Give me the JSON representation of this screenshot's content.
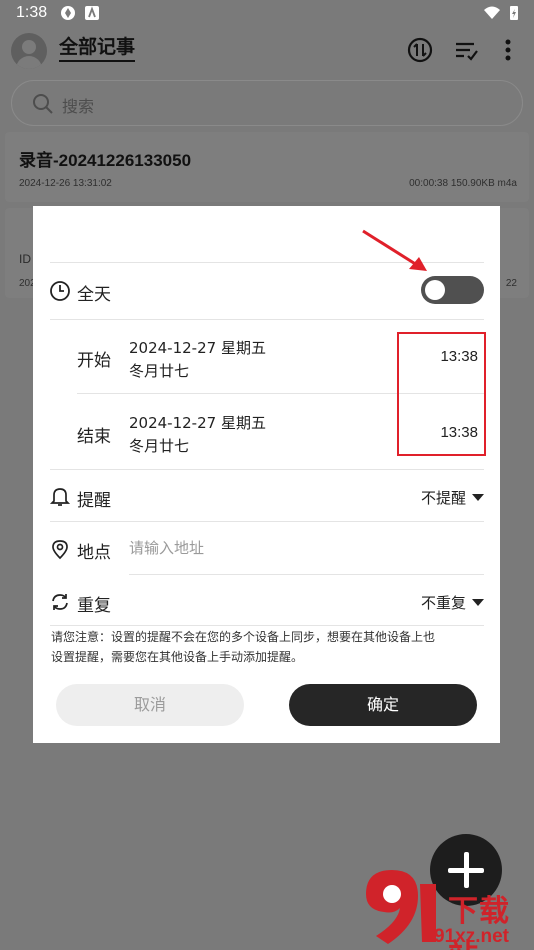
{
  "status_bar": {
    "time": "1:38"
  },
  "app": {
    "title": "全部记事",
    "search_placeholder": "搜索",
    "notes": [
      {
        "title": "录音-20241226133050",
        "date": "2024-12-26 13:31:02",
        "meta": "00:00:38 150.90KB m4a"
      },
      {
        "id_text": "ID",
        "date": "202",
        "meta": "22"
      }
    ]
  },
  "dialog": {
    "all_day_label": "全天",
    "all_day_on": false,
    "start": {
      "label": "开始",
      "date": "2024-12-27 星期五",
      "lunar": "冬月廿七",
      "time": "13:38"
    },
    "end": {
      "label": "结束",
      "date": "2024-12-27 星期五",
      "lunar": "冬月廿七",
      "time": "13:38"
    },
    "reminder": {
      "label": "提醒",
      "value": "不提醒"
    },
    "location": {
      "label": "地点",
      "placeholder": "请输入地址"
    },
    "repeat": {
      "label": "重复",
      "value": "不重复"
    },
    "notice_line1": "请您注意：设置的提醒不会在您的多个设备上同步，想要在其他设备上也",
    "notice_line2": "设置提醒，需要您在其他设备上手动添加提醒。",
    "cancel_label": "取消",
    "confirm_label": "确定"
  },
  "watermark": {
    "top": "下载站",
    "bottom": "91xz.net"
  },
  "colors": {
    "accent": "#262626",
    "annotation": "#e0202a",
    "overlay": "#7a7a7a"
  }
}
